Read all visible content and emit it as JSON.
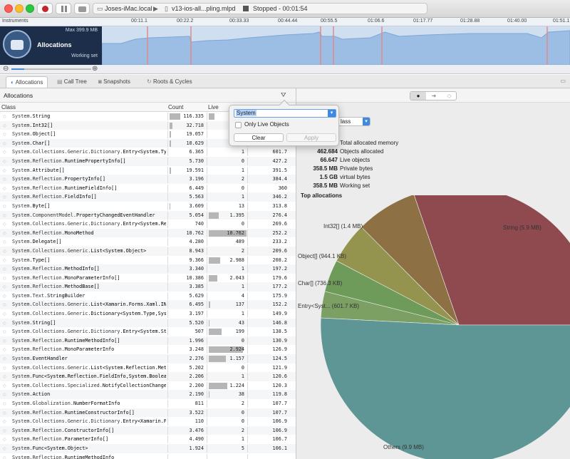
{
  "toolbar": {
    "device": "Joses-iMac.local",
    "target": "v13-ios-all...pling.mlpd",
    "status": "Stopped - 00:01:54"
  },
  "timeline": {
    "ruler_label": "Instruments",
    "ticks": [
      "00:11.1",
      "00:22.2",
      "00:33.33",
      "00:44.44",
      "00:55.5",
      "01:06.6",
      "01:17.77",
      "01:28.88",
      "01:40.00",
      "01:51.1"
    ],
    "track": {
      "name": "Allocations",
      "max": "Max 399.9 MB",
      "footer": "Working set"
    }
  },
  "tabs": [
    {
      "label": "Allocations"
    },
    {
      "label": "Call Tree"
    },
    {
      "label": "Snapshots"
    },
    {
      "label": "Roots & Cycles"
    }
  ],
  "breadcrumb": "Allocations",
  "columns": {
    "class": "Class",
    "count": "Count",
    "live": "Live"
  },
  "rows": [
    {
      "prefix": "System.",
      "name": "String",
      "count": "116.335",
      "live": "1",
      "size": ""
    },
    {
      "prefix": "System.",
      "name": "Int32[]",
      "count": "32.718",
      "live": "1",
      "size": ""
    },
    {
      "prefix": "System.",
      "name": "Object[]",
      "count": "19.057",
      "live": "",
      "size": ""
    },
    {
      "prefix": "System.",
      "name": "Char[]",
      "count": "10.629",
      "live": "",
      "size": ""
    },
    {
      "prefix": "System.Collections.Generic.Dictionary.",
      "name": "Entry<System.Typ",
      "count": "6.365",
      "live": "1",
      "size": "601.7"
    },
    {
      "prefix": "System.Reflection.",
      "name": "RuntimePropertyInfo[]",
      "count": "5.730",
      "live": "0",
      "size": "427.2"
    },
    {
      "prefix": "System.",
      "name": "Attribute[]",
      "count": "19.591",
      "live": "1",
      "size": "391.5"
    },
    {
      "prefix": "System.Reflection.",
      "name": "PropertyInfo[]",
      "count": "3.196",
      "live": "2",
      "size": "384.4"
    },
    {
      "prefix": "System.Reflection.",
      "name": "RuntimeFieldInfo[]",
      "count": "6.449",
      "live": "0",
      "size": "360"
    },
    {
      "prefix": "System.Reflection.",
      "name": "FieldInfo[]",
      "count": "5.563",
      "live": "1",
      "size": "346.2"
    },
    {
      "prefix": "System.",
      "name": "Byte[]",
      "count": "3.609",
      "live": "13",
      "size": "313.8"
    },
    {
      "prefix": "System.ComponentModel.",
      "name": "PropertyChangedEventHandler",
      "count": "5.054",
      "live": "1.395",
      "size": "276.4"
    },
    {
      "prefix": "System.Collections.Generic.Dictionary.",
      "name": "Entry<System.Refl",
      "count": "740",
      "live": "0",
      "size": "269.6"
    },
    {
      "prefix": "System.Reflection.",
      "name": "MonoMethod",
      "count": "10.762",
      "live": "10.762",
      "size": "252.2"
    },
    {
      "prefix": "System.",
      "name": "Delegate[]",
      "count": "4.280",
      "live": "489",
      "size": "233.2"
    },
    {
      "prefix": "System.Collections.Generic.",
      "name": "List<System.Object>",
      "count": "8.943",
      "live": "2",
      "size": "209.6"
    },
    {
      "prefix": "System.",
      "name": "Type[]",
      "count": "9.366",
      "live": "2.988",
      "size": "208.2"
    },
    {
      "prefix": "System.Reflection.",
      "name": "MethodInfo[]",
      "count": "3.340",
      "live": "1",
      "size": "197.2"
    },
    {
      "prefix": "System.Reflection.",
      "name": "MonoParameterInfo[]",
      "count": "10.386",
      "live": "2.043",
      "size": "179.6"
    },
    {
      "prefix": "System.Reflection.",
      "name": "MethodBase[]",
      "count": "3.385",
      "live": "1",
      "size": "177.2"
    },
    {
      "prefix": "System.Text.",
      "name": "StringBuilder",
      "count": "5.629",
      "live": "4",
      "size": "175.9"
    },
    {
      "prefix": "System.Collections.Generic.",
      "name": "List<Xamarin.Forms.Xaml.INo",
      "count": "6.495",
      "live": "137",
      "size": "152.2"
    },
    {
      "prefix": "System.Collections.Generic.",
      "name": "Dictionary<System.Type,Syst",
      "count": "3.197",
      "live": "1",
      "size": "149.9"
    },
    {
      "prefix": "System.",
      "name": "String[]",
      "count": "5.520",
      "live": "43",
      "size": "146.8"
    },
    {
      "prefix": "System.Collections.Generic.Dictionary.",
      "name": "Entry<System.Str",
      "count": "507",
      "live": "199",
      "size": "138.5"
    },
    {
      "prefix": "System.Reflection.",
      "name": "RuntimeMethodInfo[]",
      "count": "1.996",
      "live": "0",
      "size": "130.9"
    },
    {
      "prefix": "System.Reflection.",
      "name": "MonoParameterInfo",
      "count": "3.248",
      "live": "2.924",
      "size": "126.9"
    },
    {
      "prefix": "System.",
      "name": "EventHandler",
      "count": "2.276",
      "live": "1.157",
      "size": "124.5"
    },
    {
      "prefix": "System.Collections.Generic.",
      "name": "List<System.Reflection.Meth",
      "count": "5.202",
      "live": "0",
      "size": "121.9"
    },
    {
      "prefix": "System.",
      "name": "Func<System.Reflection.FieldInfo,System.Boolean",
      "count": "2.206",
      "live": "1",
      "size": "120.6"
    },
    {
      "prefix": "System.Collections.Specialized.",
      "name": "NotifyCollectionChanged",
      "count": "2.200",
      "live": "1.224",
      "size": "120.3"
    },
    {
      "prefix": "System.",
      "name": "Action",
      "count": "2.190",
      "live": "38",
      "size": "119.8"
    },
    {
      "prefix": "System.Globalization.",
      "name": "NumberFormatInfo",
      "count": "811",
      "live": "2",
      "size": "107.7"
    },
    {
      "prefix": "System.Reflection.",
      "name": "RuntimeConstructorInfo[]",
      "count": "3.522",
      "live": "0",
      "size": "107.7"
    },
    {
      "prefix": "System.Collections.Generic.Dictionary.",
      "name": "Entry<Xamarin.Fo",
      "count": "110",
      "live": "0",
      "size": "106.9"
    },
    {
      "prefix": "System.Reflection.",
      "name": "ConstructorInfo[]",
      "count": "3.476",
      "live": "2",
      "size": "106.9"
    },
    {
      "prefix": "System.Reflection.",
      "name": "ParameterInfo[]",
      "count": "4.490",
      "live": "1",
      "size": "106.7"
    },
    {
      "prefix": "System.",
      "name": "Func<System.Object>",
      "count": "1.924",
      "live": "5",
      "size": "106.1"
    },
    {
      "prefix": "System.Reflection.",
      "name": "RuntimeMethodInfo",
      "count": "",
      "live": "",
      "size": ""
    }
  ],
  "filter": {
    "value": "System",
    "checkbox": "Only Live Objects",
    "clear": "Clear",
    "apply": "Apply"
  },
  "summary": {
    "select_value": "lass",
    "items": [
      {
        "value": "",
        "label": "Total allocated memory"
      },
      {
        "value": "462.684",
        "label": "Objects allocated"
      },
      {
        "value": "66.647",
        "label": "Live objects"
      },
      {
        "value": "358.5 MB",
        "label": "Private bytes"
      },
      {
        "value": "1.5 GB",
        "label": "virtual bytes"
      },
      {
        "value": "358.5 MB",
        "label": "Working set"
      }
    ],
    "top_title": "Top allocations"
  },
  "chart_data": {
    "type": "pie",
    "title": "Top allocations",
    "labels": [
      "String (5.9 MB)",
      "Others (9.9 MB)",
      "Entry<Syst... (601.7 KB)",
      "Char[] (736.3 KB)",
      "Object[] (944.1 KB)",
      "Int32[] (1.4 MB)"
    ],
    "values": [
      5.9,
      9.9,
      0.6017,
      0.7363,
      0.9441,
      1.4
    ],
    "colors": [
      "#8e4a4f",
      "#5d9695",
      "#7c9f63",
      "#6e9a5a",
      "#94944f",
      "#8d7043"
    ]
  }
}
